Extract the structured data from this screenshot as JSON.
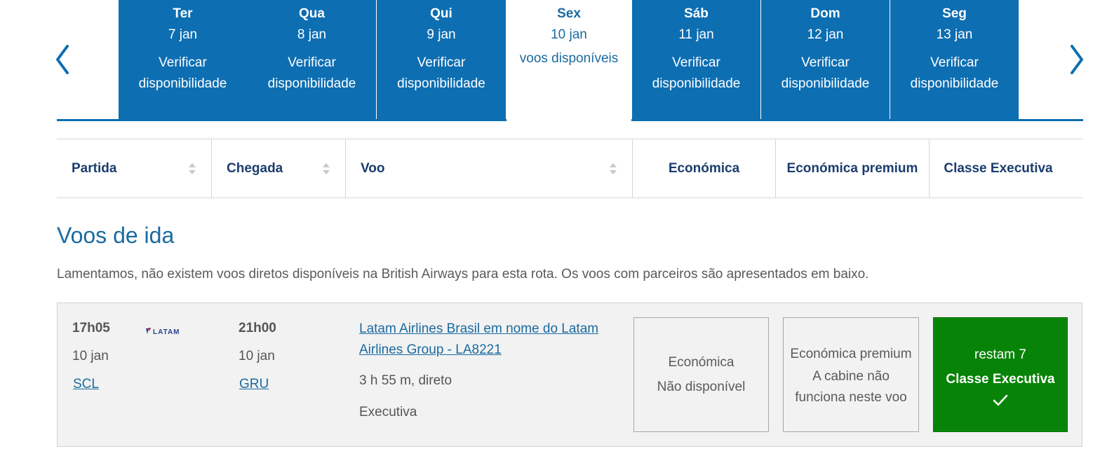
{
  "carousel": {
    "days": [
      {
        "name": "Ter",
        "date": "7 jan",
        "status": "Verificar disponibilidade"
      },
      {
        "name": "Qua",
        "date": "8 jan",
        "status": "Verificar disponibilidade"
      },
      {
        "name": "Qui",
        "date": "9 jan",
        "status": "Verificar disponibilidade"
      },
      {
        "name": "Sex",
        "date": "10 jan",
        "status": "voos disponíveis",
        "selected": true
      },
      {
        "name": "Sáb",
        "date": "11 jan",
        "status": "Verificar disponibilidade"
      },
      {
        "name": "Dom",
        "date": "12 jan",
        "status": "Verificar disponibilidade"
      },
      {
        "name": "Seg",
        "date": "13 jan",
        "status": "Verificar disponibilidade"
      }
    ],
    "prev_icon": "chevron-left-icon",
    "next_icon": "chevron-right-icon"
  },
  "sort_header": {
    "departure": "Partida",
    "arrival": "Chegada",
    "flight": "Voo",
    "economy": "Económica",
    "premium_economy": "Económica premium",
    "business": "Classe Executiva"
  },
  "section": {
    "title": "Voos de ida",
    "notice": "Lamentamos, não existem voos diretos disponíveis na British Airways para esta rota. Os voos com parceiros são apresentados em baixo."
  },
  "flight": {
    "departure": {
      "time": "17h05",
      "date": "10 jan",
      "airport": "SCL"
    },
    "arrival": {
      "time": "21h00",
      "date": "10 jan",
      "airport": "GRU"
    },
    "airline_logo": "LATAM",
    "operator_link": "Latam Airlines Brasil em nome do Latam Airlines Group - LA8221",
    "duration": "3 h 55 m, direto",
    "cabin": "Executiva",
    "fares": {
      "economy": {
        "class": "Económica",
        "status": "Não disponível"
      },
      "premium": {
        "class": "Económica premium",
        "status_line1": "A cabine não",
        "status_line2": "funciona neste voo"
      },
      "business": {
        "remaining": "restam 7",
        "class": "Classe Executiva",
        "icon": "checkmark-icon"
      }
    }
  },
  "colors": {
    "tab_blue": "#0d6eb2",
    "link_blue": "#1a6aa0",
    "header_navy": "#1b3d6e",
    "selected_green": "#078307"
  }
}
